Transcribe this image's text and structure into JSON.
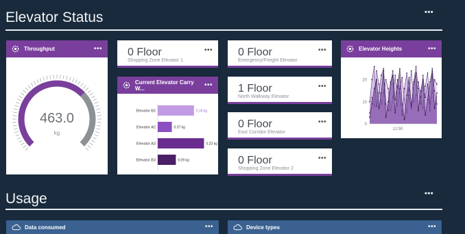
{
  "sections": {
    "elevator_status": {
      "title": "Elevator Status"
    },
    "usage": {
      "title": "Usage"
    }
  },
  "menu_label": "•••",
  "throughput": {
    "title": "Throughput",
    "value": "463.0",
    "unit": "kg",
    "gauge_fraction": 0.67,
    "accent": "#7a3f9d",
    "track": "#8c9196"
  },
  "floor_cards": [
    {
      "value": "0 Floor",
      "label": "Shopping Zone Elevator 1"
    },
    {
      "value": "0 Floor",
      "label": "Emergency/Freight Elevator"
    },
    {
      "value": "1 Floor",
      "label": "North Walkway Elevator"
    },
    {
      "value": "0 Floor",
      "label": "East Corridor Elevator"
    },
    {
      "value": "0 Floor",
      "label": "Shopping Zone Elevator 2"
    }
  ],
  "carry_weight": {
    "title": "Current Elevator Carry W...",
    "chart_data": {
      "type": "bar",
      "orientation": "horizontal",
      "categories": [
        "Elevator B2",
        "Elevator A2",
        "Elevator A3",
        "Elevator B3"
      ],
      "values": [
        0.18,
        0.07,
        0.23,
        0.09
      ],
      "value_labels": [
        "0.18 kg",
        "0.07 kg",
        "0.23 kg",
        "0.09 kg"
      ],
      "colors": [
        "#c29be4",
        "#8a4fc1",
        "#6a2d8f",
        "#4a1f66"
      ],
      "xlim": [
        0,
        0.3
      ]
    }
  },
  "heights": {
    "title": "Elevator Heights",
    "chart_data": {
      "type": "area",
      "y_ticks": [
        "20",
        "10",
        "0"
      ],
      "ylim": [
        0,
        27
      ],
      "x_tick_label": "12:50",
      "series": [
        {
          "values": [
            3,
            9,
            16,
            20,
            7,
            14,
            24,
            3,
            10,
            19,
            22,
            5,
            17,
            25,
            9,
            2,
            13,
            21,
            8,
            18,
            23,
            6,
            15,
            20,
            4,
            11,
            19,
            24,
            7,
            14
          ]
        },
        {
          "values": [
            10,
            20,
            26,
            8,
            14,
            22,
            25,
            9,
            6,
            18,
            24,
            11,
            20,
            14,
            4,
            16,
            23,
            13,
            7,
            19,
            26,
            16,
            9,
            22,
            12,
            18,
            6,
            25,
            15,
            9
          ]
        },
        {
          "values": [
            5,
            12,
            8,
            24,
            18,
            9,
            14,
            20,
            16,
            6,
            12,
            22,
            8,
            16,
            21,
            11,
            5,
            15,
            24,
            10,
            13,
            19,
            12,
            7,
            17,
            23,
            9,
            14,
            20,
            18
          ]
        }
      ],
      "colors": [
        "#6d3a97",
        "#a478cc",
        "#c9a9e6"
      ]
    }
  },
  "usage_cards": [
    {
      "title": "Data consumed"
    },
    {
      "title": "Device types"
    }
  ]
}
